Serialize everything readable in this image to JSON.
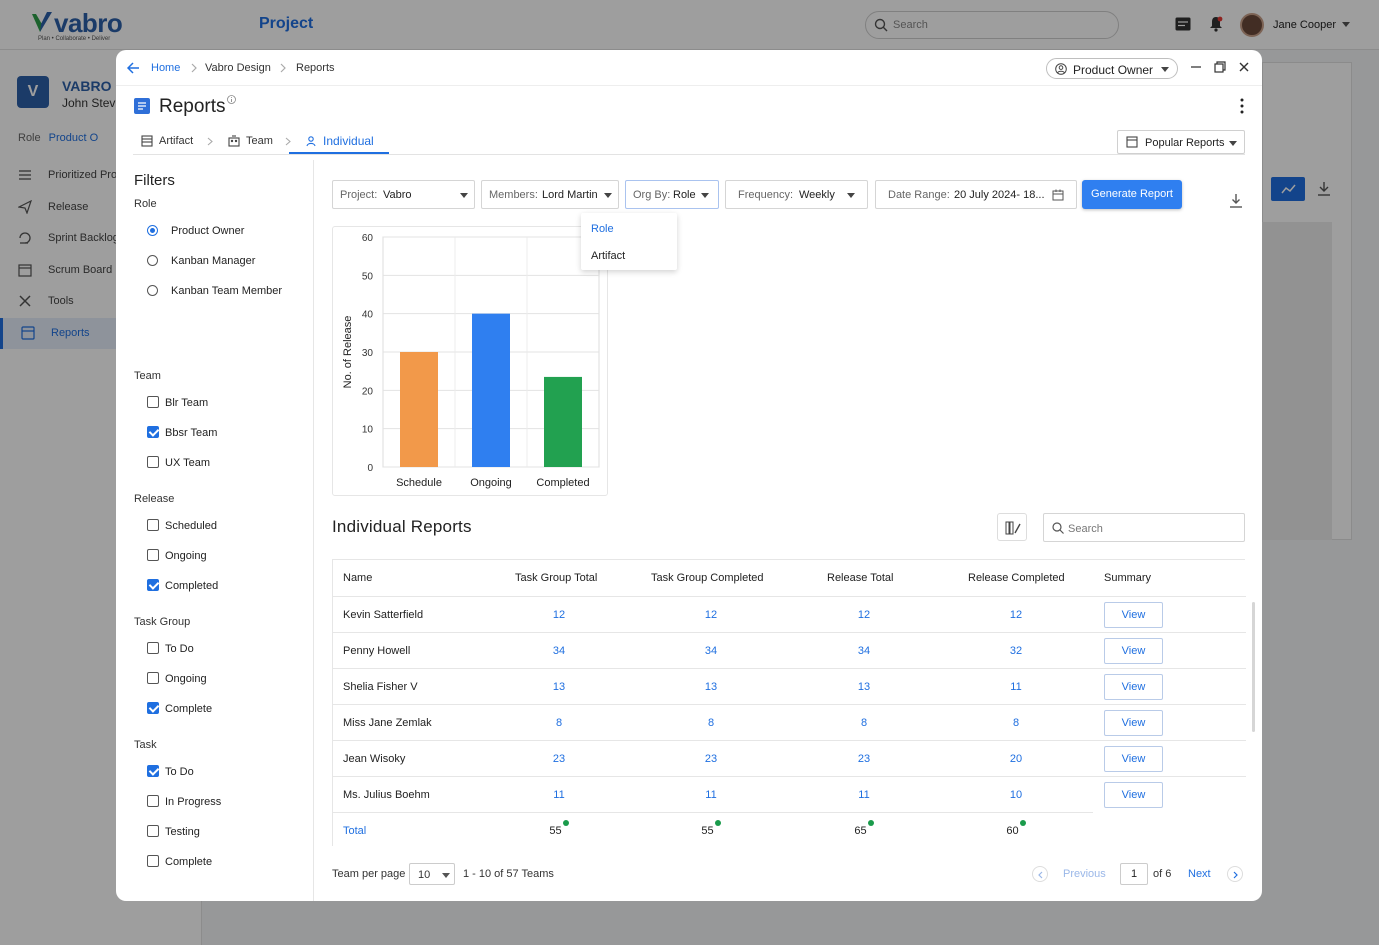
{
  "app": {
    "brand": "vabro",
    "tagline": "Plan • Collaborate • Deliver",
    "project_label": "Project",
    "search_placeholder": "Search",
    "user_name": "Jane Cooper"
  },
  "bg_sidebar": {
    "avatar_letter": "V",
    "org": "VABRO",
    "user": "John Stev",
    "role_label": "Role",
    "role_value": "Product O",
    "items": [
      {
        "label": "Prioritized Pro",
        "icon": "list-icon"
      },
      {
        "label": "Release",
        "icon": "send-icon"
      },
      {
        "label": "Sprint Backlog",
        "icon": "cycle-icon"
      },
      {
        "label": "Scrum Board",
        "icon": "calendar-icon"
      },
      {
        "label": "Tools",
        "icon": "tools-icon"
      },
      {
        "label": "Reports",
        "icon": "reports-icon"
      }
    ]
  },
  "modal": {
    "breadcrumb": [
      "Home",
      "Vabro Design",
      "Reports"
    ],
    "role_select": "Product Owner",
    "title": "Reports",
    "tabs": [
      {
        "label": "Artifact",
        "icon": "artifact-icon"
      },
      {
        "label": "Team",
        "icon": "team-icon"
      },
      {
        "label": "Individual",
        "icon": "person-icon"
      }
    ],
    "popular_reports": "Popular Reports"
  },
  "filters": {
    "title": "Filters",
    "groups": [
      {
        "label": "Role",
        "type": "radio",
        "options": [
          {
            "label": "Product Owner",
            "checked": true
          },
          {
            "label": "Kanban Manager",
            "checked": false
          },
          {
            "label": "Kanban Team Member",
            "checked": false
          }
        ]
      },
      {
        "label": "Team",
        "type": "checkbox",
        "options": [
          {
            "label": "Blr Team",
            "checked": false
          },
          {
            "label": "Bbsr Team",
            "checked": true
          },
          {
            "label": "UX Team",
            "checked": false
          }
        ]
      },
      {
        "label": "Release",
        "type": "checkbox",
        "options": [
          {
            "label": "Scheduled",
            "checked": false
          },
          {
            "label": "Ongoing",
            "checked": false
          },
          {
            "label": "Completed",
            "checked": true
          }
        ]
      },
      {
        "label": "Task Group",
        "type": "checkbox",
        "options": [
          {
            "label": "To Do",
            "checked": false
          },
          {
            "label": "Ongoing",
            "checked": false
          },
          {
            "label": "Complete",
            "checked": true
          }
        ]
      },
      {
        "label": "Task",
        "type": "checkbox",
        "options": [
          {
            "label": "To Do",
            "checked": true
          },
          {
            "label": "In Progress",
            "checked": false
          },
          {
            "label": "Testing",
            "checked": false
          },
          {
            "label": "Complete",
            "checked": false
          }
        ]
      }
    ]
  },
  "toolbar": {
    "project": {
      "key": "Project:",
      "value": "Vabro"
    },
    "members": {
      "key": "Members:",
      "value": "Lord Martin"
    },
    "org_by": {
      "key": "Org By:",
      "value": "Role"
    },
    "frequency": {
      "key": "Frequency:",
      "value": "Weekly"
    },
    "date_range": {
      "key": "Date Range:",
      "value": "20 July 2024- 18..."
    },
    "generate": "Generate Report"
  },
  "org_by_dropdown": {
    "options": [
      "Role",
      "Artifact"
    ],
    "selected": "Role"
  },
  "chart_data": {
    "type": "bar",
    "categories": [
      "Schedule",
      "Ongoing",
      "Completed"
    ],
    "values": [
      30,
      40,
      23.5
    ],
    "colors": [
      "#f2994a",
      "#2f7ff0",
      "#22a150"
    ],
    "ylabel": "No. of Release",
    "xlabel": "",
    "ylim": [
      0,
      60
    ],
    "yticks": [
      0,
      10,
      20,
      30,
      40,
      50,
      60
    ],
    "grid": true
  },
  "table": {
    "title": "Individual  Reports",
    "search_placeholder": "Search",
    "columns": [
      "Name",
      "Task Group Total",
      "Task Group Completed",
      "Release Total",
      "Release Completed",
      "Summary"
    ],
    "rows": [
      {
        "name": "Kevin Satterfield",
        "tgt": "12",
        "tgc": "12",
        "rt": "12",
        "rc": "12",
        "summary": "View"
      },
      {
        "name": "Penny Howell",
        "tgt": "34",
        "tgc": "34",
        "rt": "34",
        "rc": "32",
        "summary": "View"
      },
      {
        "name": "Shelia Fisher V",
        "tgt": "13",
        "tgc": "13",
        "rt": "13",
        "rc": "11",
        "summary": "View"
      },
      {
        "name": "Miss Jane Zemlak",
        "tgt": "8",
        "tgc": "8",
        "rt": "8",
        "rc": "8",
        "summary": "View"
      },
      {
        "name": "Jean Wisoky",
        "tgt": "23",
        "tgc": "23",
        "rt": "23",
        "rc": "20",
        "summary": "View"
      },
      {
        "name": "Ms. Julius Boehm",
        "tgt": "11",
        "tgc": "11",
        "rt": "11",
        "rc": "10",
        "summary": "View"
      }
    ],
    "total": {
      "label": "Total",
      "tgt": "55",
      "tgc": "55",
      "rt": "65",
      "rc": "60"
    }
  },
  "pagination": {
    "per_page_label": "Team per page",
    "per_page": "10",
    "range": "1 - 10 of 57 Teams",
    "previous": "Previous",
    "page": "1",
    "of": "of 6",
    "next": "Next"
  }
}
